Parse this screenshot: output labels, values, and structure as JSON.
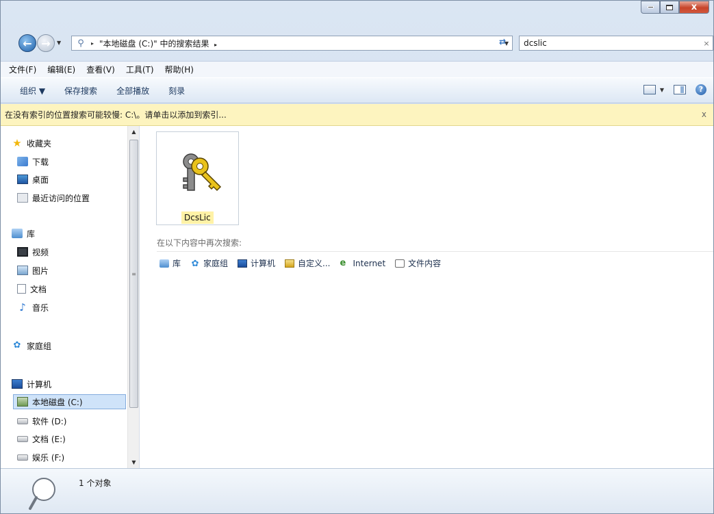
{
  "window": {
    "controls": {
      "minimize": "",
      "maximize": "",
      "close": "x"
    }
  },
  "address": {
    "path": "\"本地磁盘 (C:)\" 中的搜索结果",
    "path_sep": "▸",
    "path_end_sep": "▸"
  },
  "search": {
    "value": "dcslic",
    "clear": "×"
  },
  "menu": {
    "items": [
      "文件(F)",
      "编辑(E)",
      "查看(V)",
      "工具(T)",
      "帮助(H)"
    ]
  },
  "toolbar": {
    "organize": "组织 ▼",
    "save_search": "保存搜索",
    "play_all": "全部播放",
    "burn": "刻录",
    "help": "?"
  },
  "infobar": {
    "message": "在没有索引的位置搜索可能较慢: C:\\。请单击以添加到索引...",
    "close": "x"
  },
  "sidebar": {
    "favorites": {
      "title": "收藏夹",
      "items": [
        "下载",
        "桌面",
        "最近访问的位置"
      ]
    },
    "libraries": {
      "title": "库",
      "items": [
        "视频",
        "图片",
        "文档",
        "音乐"
      ]
    },
    "homegroup": "家庭组",
    "computer": {
      "title": "计算机",
      "items": [
        "本地磁盘 (C:)",
        "软件 (D:)",
        "文档 (E:)",
        "娱乐 (F:)"
      ]
    }
  },
  "results": {
    "files": [
      {
        "name": "DcsLic",
        "icon": "key-icon"
      }
    ],
    "search_again_label": "在以下内容中再次搜索:",
    "search_again_links": [
      "库",
      "家庭组",
      "计算机",
      "自定义...",
      "Internet",
      "文件内容"
    ]
  },
  "status": {
    "count": "1 个对象",
    "icon": "magnifier-icon"
  }
}
